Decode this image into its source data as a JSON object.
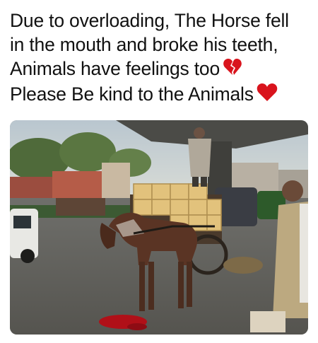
{
  "post": {
    "lines": [
      "Due to overloading, The Horse fell",
      "in the mouth and broke his teeth,",
      "Animals have feelings too",
      "Please Be kind to the Animals"
    ],
    "emojis": [
      "broken-heart-icon",
      "red-heart-icon"
    ],
    "colors": {
      "text": "#111111",
      "heart_red": "#d9141d",
      "blood": "#b01018"
    }
  },
  "photo": {
    "subjects": [
      "horse-cart",
      "cardboard-boxes",
      "man-on-cart",
      "man-on-right",
      "overpass",
      "street-traffic",
      "blood-on-road"
    ]
  }
}
